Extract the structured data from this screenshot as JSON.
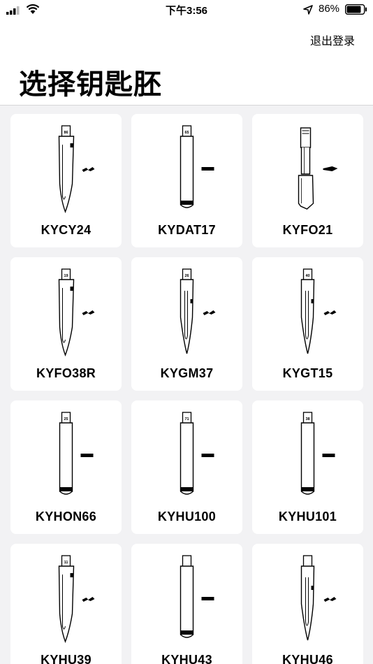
{
  "status_bar": {
    "time": "下午3:56",
    "battery": "86%",
    "icons": [
      "signal-icon",
      "wifi-icon",
      "location-icon",
      "battery-icon"
    ]
  },
  "header": {
    "logout_label": "退出登录",
    "title": "选择钥匙胚"
  },
  "keys": [
    {
      "name": "KYCY24",
      "tag": "86",
      "shape": "blade"
    },
    {
      "name": "KYDAT17",
      "tag": "65",
      "shape": "plain"
    },
    {
      "name": "KYFO21",
      "tag": "",
      "shape": "ford"
    },
    {
      "name": "KYFO38R",
      "tag": "19",
      "shape": "blade"
    },
    {
      "name": "KYGM37",
      "tag": "26",
      "shape": "grooved"
    },
    {
      "name": "KYGT15",
      "tag": "40",
      "shape": "grooved"
    },
    {
      "name": "KYHON66",
      "tag": "25",
      "shape": "plain"
    },
    {
      "name": "KYHU100",
      "tag": "71",
      "shape": "plain"
    },
    {
      "name": "KYHU101",
      "tag": "38",
      "shape": "plain"
    },
    {
      "name": "KYHU39",
      "tag": "11",
      "shape": "blade"
    },
    {
      "name": "KYHU43",
      "tag": "",
      "shape": "plain"
    },
    {
      "name": "KYHU46",
      "tag": "",
      "shape": "grooved"
    }
  ]
}
